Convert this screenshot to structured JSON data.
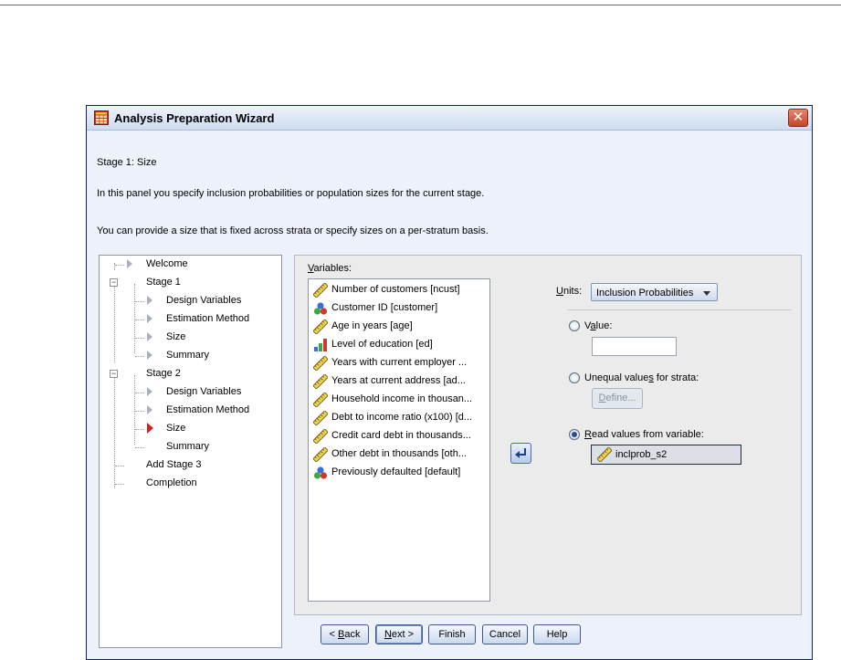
{
  "window": {
    "title": "Analysis Preparation Wizard",
    "close_glyph": "✕"
  },
  "header": {
    "stage_title": "Stage 1: Size",
    "description": "In this panel you specify inclusion probabilities or population sizes for the current stage.",
    "hint": "You can provide a size that is fixed across strata or specify sizes on a per-stratum basis."
  },
  "tree": {
    "items": [
      {
        "label": "Welcome"
      },
      {
        "label": "Stage 1"
      },
      {
        "label": "Design Variables"
      },
      {
        "label": "Estimation Method"
      },
      {
        "label": "Size"
      },
      {
        "label": "Summary"
      },
      {
        "label": "Stage 2"
      },
      {
        "label": "Design Variables"
      },
      {
        "label": "Estimation Method"
      },
      {
        "label": "Size"
      },
      {
        "label": "Summary"
      },
      {
        "label": "Add Stage 3"
      },
      {
        "label": "Completion"
      }
    ]
  },
  "variables": {
    "label_underlined": "V",
    "label_rest": "ariables:",
    "items": [
      {
        "label": "Number of customers [ncust]",
        "icon": "ruler-scale-icon"
      },
      {
        "label": "Customer ID [customer]",
        "icon": "nominal-balls-icon"
      },
      {
        "label": "Age in years [age]",
        "icon": "ruler-scale-icon"
      },
      {
        "label": "Level of education [ed]",
        "icon": "ordinal-bars-icon"
      },
      {
        "label": "Years with current employer ...",
        "icon": "ruler-scale-icon"
      },
      {
        "label": "Years at current address [ad...",
        "icon": "ruler-scale-icon"
      },
      {
        "label": "Household income in thousan...",
        "icon": "ruler-scale-icon"
      },
      {
        "label": "Debt to income ratio (x100) [d...",
        "icon": "ruler-scale-icon"
      },
      {
        "label": "Credit card debt in thousands...",
        "icon": "ruler-scale-icon"
      },
      {
        "label": "Other debt in thousands [oth...",
        "icon": "ruler-scale-icon"
      },
      {
        "label": "Previously defaulted [default]",
        "icon": "nominal-balls-icon"
      }
    ]
  },
  "units": {
    "label_underlined": "U",
    "label_rest": "nits:",
    "selected": "Inclusion Probabilities"
  },
  "options": {
    "value_pre": "V",
    "value_ul": "a",
    "value_post": "lue:",
    "unequal_pre": "Unequal value",
    "unequal_ul": "s",
    "unequal_post": " for strata:",
    "define_pre": "",
    "define_ul": "D",
    "define_post": "efine...",
    "read_pre": "",
    "read_ul": "R",
    "read_post": "ead values from variable:",
    "selected_option": "read",
    "read_variable": "inclprob_s2"
  },
  "buttons": {
    "back_pre": "< ",
    "back_ul": "B",
    "back_post": "ack",
    "next_pre": "",
    "next_ul": "N",
    "next_post": "ext >",
    "finish": "Finish",
    "cancel": "Cancel",
    "help": "Help"
  },
  "colors": {
    "accent": "#2b4c8a",
    "close": "#c8432d"
  }
}
